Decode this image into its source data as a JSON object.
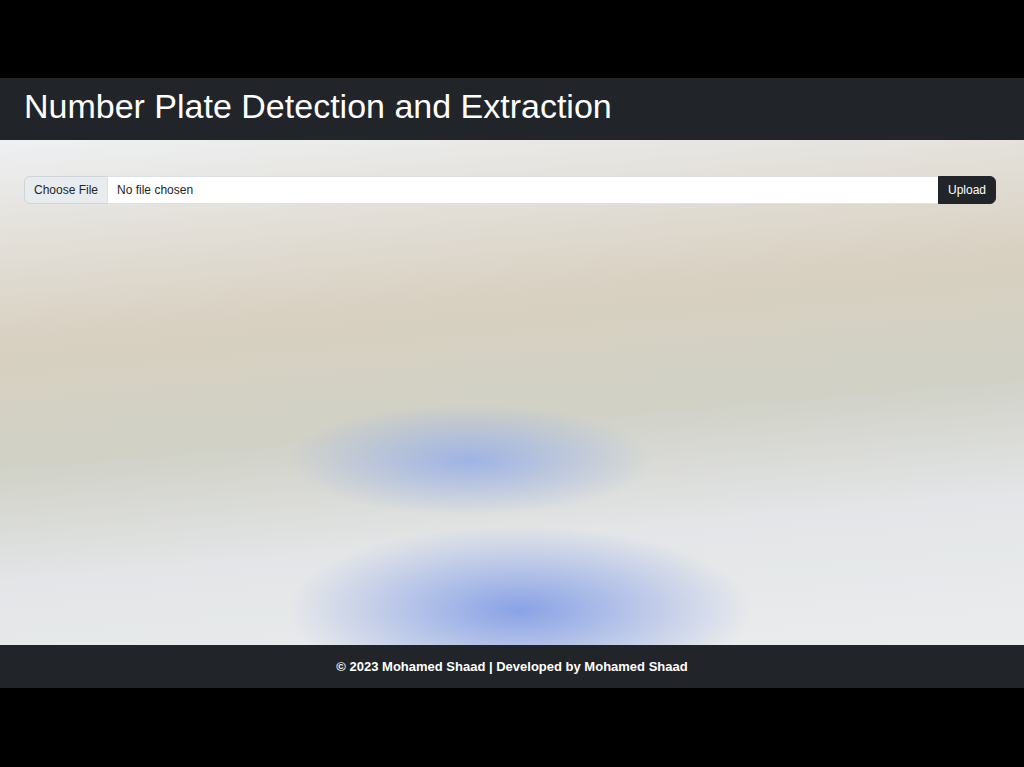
{
  "header": {
    "title": "Number Plate Detection and Extraction"
  },
  "upload": {
    "choose_button": "Choose File",
    "file_label": "No file chosen",
    "submit_button": "Upload"
  },
  "footer": {
    "text": "© 2023 Mohamed Shaad | Developed by Mohamed Shaad"
  }
}
